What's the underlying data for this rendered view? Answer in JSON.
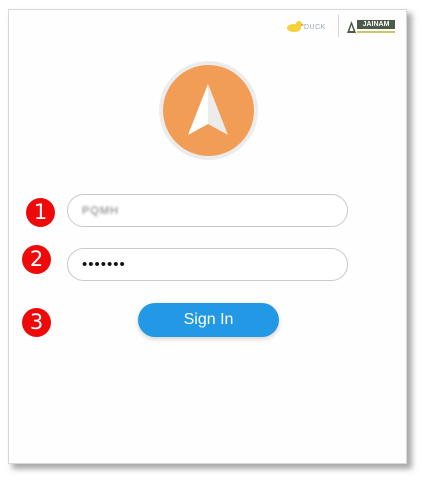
{
  "header": {
    "brand_duck_text": "DUCK",
    "brand_jainam_text": "JAINAM"
  },
  "login": {
    "username_value": "PQMH",
    "password_value": "•••••••",
    "sign_in_label": "Sign In"
  },
  "steps": [
    "1",
    "2",
    "3"
  ],
  "colors": {
    "logo_orange": "#f29d55",
    "button_blue": "#2399e6",
    "badge_red": "#ee0a0a"
  },
  "icons": {
    "app_logo": "paper-plane-icon",
    "duck_logo": "duck-icon",
    "jainam_logo": "jainam-icon"
  }
}
